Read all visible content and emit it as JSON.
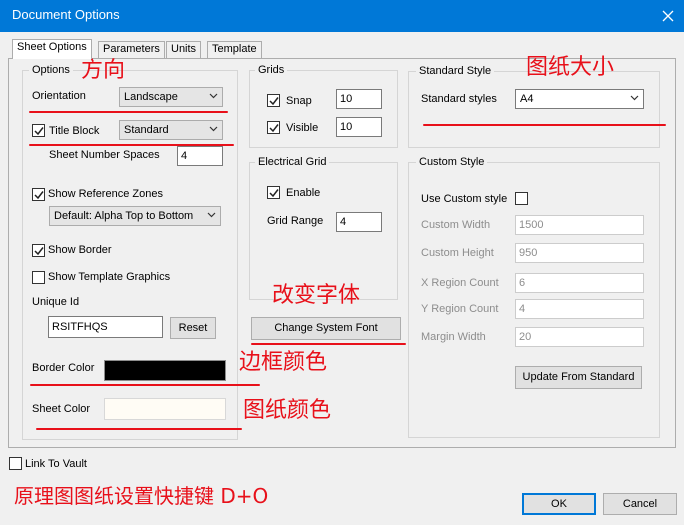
{
  "window": {
    "title": "Document Options"
  },
  "tabs": [
    {
      "label": "Sheet Options",
      "active": true
    },
    {
      "label": "Parameters",
      "active": false
    },
    {
      "label": "Units",
      "active": false
    },
    {
      "label": "Template",
      "active": false
    }
  ],
  "options": {
    "group_label": "Options",
    "orientation_label": "Orientation",
    "orientation_value": "Landscape",
    "title_block_label": "Title Block",
    "title_block_checked": true,
    "title_block_value": "Standard",
    "sheet_number_spaces_label": "Sheet Number Spaces",
    "sheet_number_spaces_value": "4",
    "show_reference_zones_label": "Show Reference Zones",
    "show_reference_zones_checked": true,
    "reference_zones_value": "Default: Alpha Top to Bottom",
    "show_border_label": "Show Border",
    "show_border_checked": true,
    "show_template_graphics_label": "Show Template Graphics",
    "show_template_graphics_checked": false,
    "unique_id_label": "Unique Id",
    "unique_id_value": "RSITFHQS",
    "reset_label": "Reset",
    "border_color_label": "Border Color",
    "border_color": "#000000",
    "sheet_color_label": "Sheet Color",
    "sheet_color": "#fffcf5"
  },
  "grids": {
    "group_label": "Grids",
    "snap_label": "Snap",
    "snap_checked": true,
    "snap_value": "10",
    "visible_label": "Visible",
    "visible_checked": true,
    "visible_value": "10"
  },
  "electrical_grid": {
    "group_label": "Electrical Grid",
    "enable_label": "Enable",
    "enable_checked": true,
    "grid_range_label": "Grid Range",
    "grid_range_value": "4"
  },
  "change_font_label": "Change System Font",
  "standard_style": {
    "group_label": "Standard Style",
    "standard_styles_label": "Standard styles",
    "standard_styles_value": "A4"
  },
  "custom_style": {
    "group_label": "Custom Style",
    "use_custom_label": "Use Custom style",
    "use_custom_checked": false,
    "custom_width_label": "Custom Width",
    "custom_width_value": "1500",
    "custom_height_label": "Custom Height",
    "custom_height_value": "950",
    "x_region_label": "X Region Count",
    "x_region_value": "6",
    "y_region_label": "Y Region Count",
    "y_region_value": "4",
    "margin_width_label": "Margin Width",
    "margin_width_value": "20",
    "update_label": "Update From Standard"
  },
  "link_to_vault_label": "Link To Vault",
  "link_to_vault_checked": false,
  "ok_label": "OK",
  "cancel_label": "Cancel",
  "annotations": {
    "orientation_note": "方向",
    "sheet_size_note": "图纸大小",
    "change_font_note": "改变字体",
    "border_color_note": "边框颜色",
    "sheet_color_note": "图纸颜色",
    "shortcut_note": "原理图图纸设置快捷键 D+O"
  },
  "colors": {
    "accent": "#0078d7",
    "annotation": "#e8101a"
  }
}
